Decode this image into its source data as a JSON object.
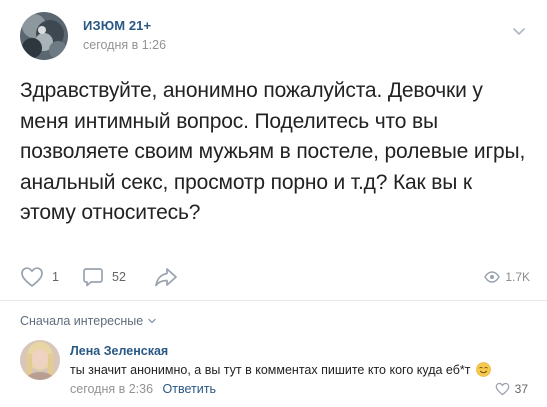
{
  "post": {
    "group_name": "ИЗЮМ 21+",
    "time": "сегодня в 1:26",
    "text": "Здравствуйте, анонимно пожалуйста. Девочки у меня интимный вопрос. Поделитесь что вы позволяете своим мужьям в постеле, ролевые игры, анальный секс, просмотр порно и т.д? Как вы к этому относитесь?",
    "likes": "1",
    "comments": "52",
    "views": "1.7K"
  },
  "comments_section": {
    "sort_label": "Сначала интересные",
    "items": [
      {
        "author": "Лена Зеленская",
        "text": "ты значит анонимно, а вы тут в комментах пишите кто кого куда еб*т",
        "time": "сегодня в 2:36",
        "reply_label": "Ответить",
        "likes": "37"
      }
    ]
  },
  "colors": {
    "link": "#2a5885",
    "secondary_text": "#939393",
    "icon": "#99a2ad"
  },
  "icons": {
    "like": "heart-icon",
    "comment": "comment-bubble-icon",
    "share": "share-arrow-icon",
    "views": "eye-icon",
    "menu": "chevron-down-icon",
    "emoji": "smiling-face-emoji"
  }
}
